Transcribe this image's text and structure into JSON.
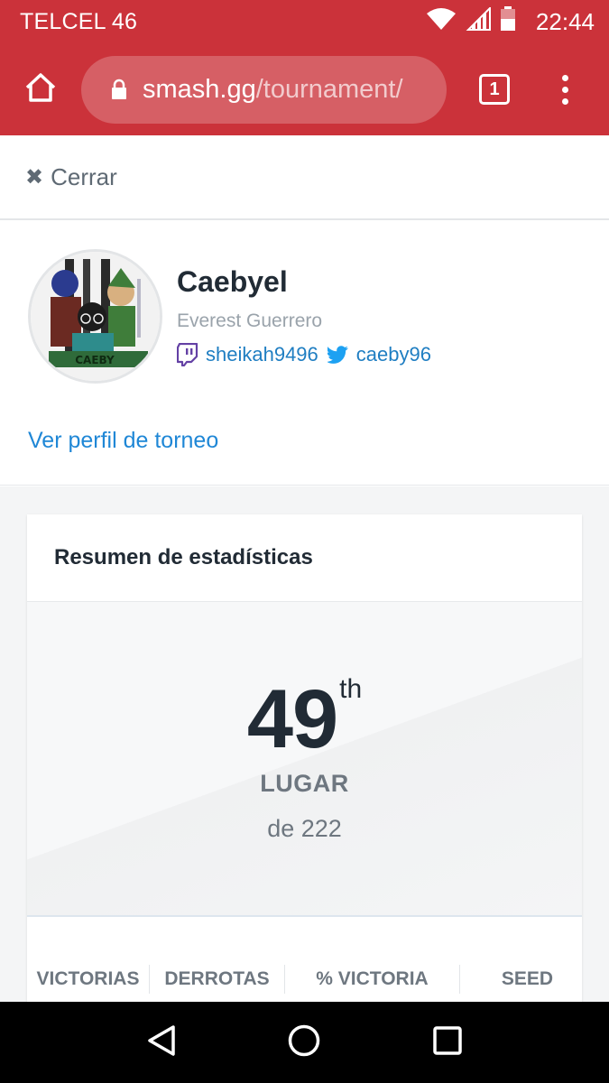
{
  "status_bar": {
    "carrier": "TELCEL 46",
    "time": "22:44"
  },
  "browser": {
    "url_host": "smash.gg",
    "url_path": "/tournament/",
    "tab_count": "1"
  },
  "close_label": "Cerrar",
  "profile": {
    "gamertag": "Caebyel",
    "real_name": "Everest Guerrero",
    "twitch": "sheikah9496",
    "twitter": "caeby96",
    "tournament_profile_link": "Ver perfil de torneo"
  },
  "stats": {
    "title": "Resumen de estadísticas",
    "placement": "49",
    "placement_suffix": "th",
    "placement_label": "LUGAR",
    "of_total": "de 222",
    "columns": [
      "VICTORIAS",
      "DERROTAS",
      "% VICTORIA",
      "SEED"
    ]
  },
  "colors": {
    "brand_red": "#cb323a",
    "link_blue": "#1f87d6",
    "twitch_purple": "#6441a5",
    "twitter_blue": "#1da1f2"
  }
}
